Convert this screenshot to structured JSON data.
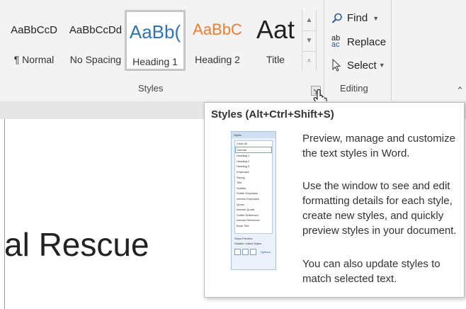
{
  "styles_gallery": {
    "items": [
      {
        "preview": "AaBbCcD",
        "label": "¶ Normal"
      },
      {
        "preview": "AaBbCcDd",
        "label": "No Spacing"
      },
      {
        "preview": "AaBb(",
        "label": "Heading 1"
      },
      {
        "preview": "AaBbC",
        "label": "Heading 2"
      },
      {
        "preview": "Aat",
        "label": "Title"
      }
    ],
    "group_label": "Styles"
  },
  "editing": {
    "find_label": "Find",
    "replace_label": "Replace",
    "select_label": "Select",
    "group_label": "Editing"
  },
  "document": {
    "visible_text": "al Rescue"
  },
  "tooltip": {
    "title": "Styles (Alt+Ctrl+Shift+S)",
    "paragraphs": [
      "Preview, manage and customize the text styles in Word.",
      "Use the window to see and edit formatting details for each style, create new styles, and quickly preview styles in your document.",
      "You can also update styles to match selected text."
    ],
    "thumbnail": {
      "title": "Styles",
      "items": [
        "Clear All",
        "Normal",
        "Heading 1",
        "Heading 2",
        "Heading 3",
        "Emphasis",
        "Strong",
        "Title",
        "Subtitle",
        "Subtle Emphasis",
        "Intense Emphasis",
        "Quote",
        "Intense Quote",
        "Subtle Reference",
        "Intense Reference",
        "Book Title"
      ],
      "checkbox_1": "Show Preview",
      "checkbox_2": "Disable Linked Styles",
      "options_link": "Options..."
    }
  },
  "colors": {
    "heading_blue": "#2e74b5",
    "heading2_orange": "#ed7d31",
    "icon_blue": "#2b579a"
  }
}
